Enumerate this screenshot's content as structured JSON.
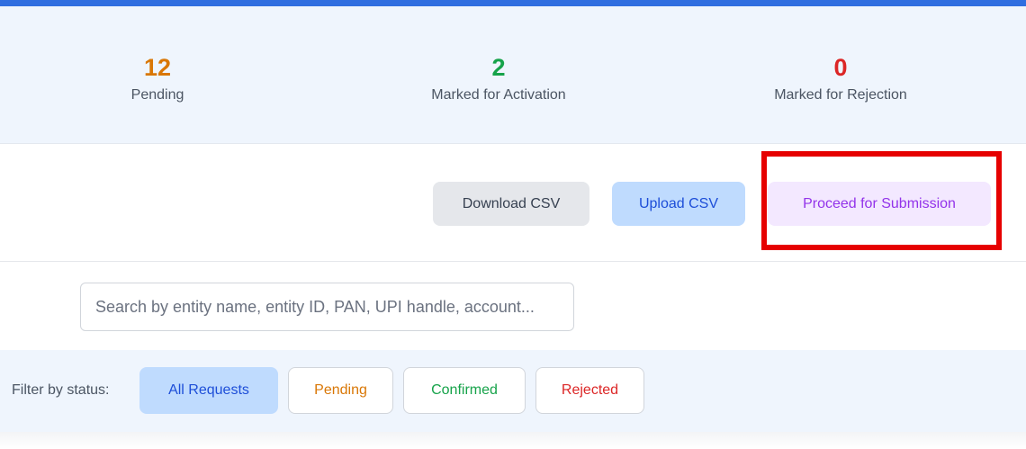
{
  "stats": {
    "pending": {
      "value": "12",
      "label": "Pending"
    },
    "activation": {
      "value": "2",
      "label": "Marked for Activation"
    },
    "rejection": {
      "value": "0",
      "label": "Marked for Rejection"
    }
  },
  "actions": {
    "download_label": "Download CSV",
    "upload_label": "Upload CSV",
    "proceed_label": "Proceed for Submission"
  },
  "search": {
    "placeholder": "Search by entity name, entity ID, PAN, UPI handle, account...",
    "value": ""
  },
  "filter": {
    "label": "Filter by status:",
    "options": [
      "All Requests",
      "Pending",
      "Confirmed",
      "Rejected"
    ],
    "selected": "All Requests"
  },
  "colors": {
    "accent_bar": "#2f6ee0",
    "pending": "#d97706",
    "activation": "#16a34a",
    "rejection": "#dc2626",
    "proceed": "#9333ea",
    "highlight": "#e60000"
  }
}
